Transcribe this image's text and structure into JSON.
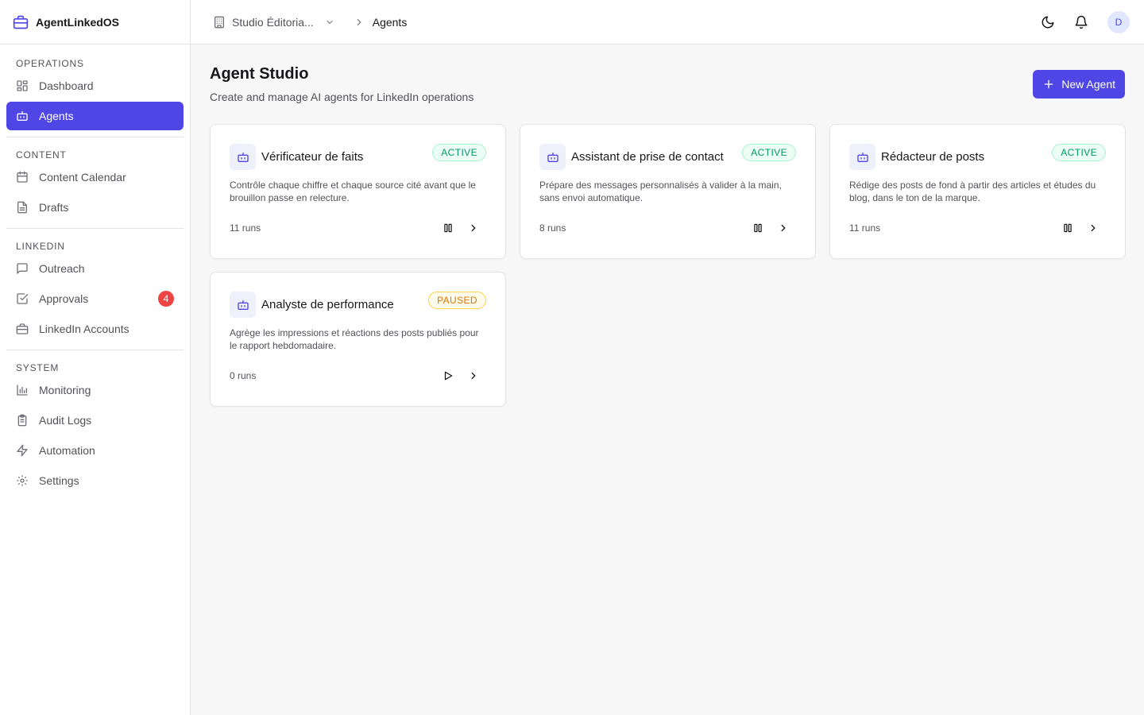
{
  "app": {
    "name": "AgentLinkedOS"
  },
  "sidebar": {
    "sections": [
      {
        "title": "OPERATIONS",
        "items": [
          {
            "label": "Dashboard",
            "icon": "dashboard-icon"
          },
          {
            "label": "Agents",
            "icon": "bot-icon",
            "active": true
          }
        ]
      },
      {
        "title": "CONTENT",
        "items": [
          {
            "label": "Content Calendar",
            "icon": "calendar-icon"
          },
          {
            "label": "Drafts",
            "icon": "document-icon"
          }
        ]
      },
      {
        "title": "LINKEDIN",
        "items": [
          {
            "label": "Outreach",
            "icon": "message-icon"
          },
          {
            "label": "Approvals",
            "icon": "check-square-icon",
            "badge": "4"
          },
          {
            "label": "LinkedIn Accounts",
            "icon": "briefcase-icon"
          }
        ]
      },
      {
        "title": "SYSTEM",
        "items": [
          {
            "label": "Monitoring",
            "icon": "bar-chart-icon"
          },
          {
            "label": "Audit Logs",
            "icon": "clipboard-icon"
          },
          {
            "label": "Automation",
            "icon": "lightning-icon"
          },
          {
            "label": "Settings",
            "icon": "gear-icon"
          }
        ]
      }
    ]
  },
  "topbar": {
    "workspace": "Studio Éditoria...",
    "current": "Agents",
    "avatar": "D"
  },
  "page": {
    "title": "Agent Studio",
    "subtitle": "Create and manage AI agents for LinkedIn operations",
    "new_button": "New Agent"
  },
  "agents": [
    {
      "name": "Vérificateur de faits",
      "status": "ACTIVE",
      "desc": "Contrôle chaque chiffre et chaque source cité avant que le brouillon passe en relecture.",
      "runs": "11 runs"
    },
    {
      "name": "Assistant de prise de contact",
      "status": "ACTIVE",
      "desc": "Prépare des messages personnalisés à valider à la main, sans envoi automatique.",
      "runs": "8 runs"
    },
    {
      "name": "Rédacteur de posts",
      "status": "ACTIVE",
      "desc": "Rédige des posts de fond à partir des articles et études du blog, dans le ton de la marque.",
      "runs": "11 runs"
    },
    {
      "name": "Analyste de performance",
      "status": "PAUSED",
      "desc": "Agrège les impressions et réactions des posts publiés pour le rapport hebdomadaire.",
      "runs": "0 runs"
    }
  ],
  "colors": {
    "accent": "#4f46e5",
    "active": "#059669",
    "paused": "#d97706",
    "badge": "#ef4444"
  }
}
